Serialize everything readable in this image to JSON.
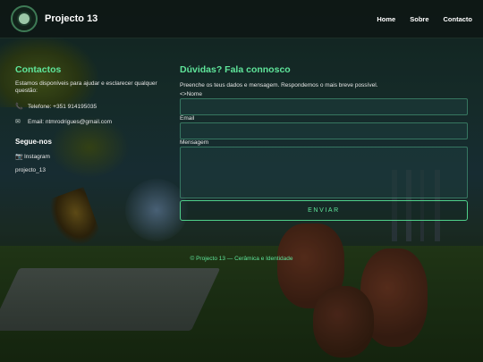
{
  "header": {
    "brand": "Projecto 13",
    "nav": [
      "Home",
      "Sobre",
      "Contacto"
    ]
  },
  "contacts": {
    "title": "Contactos",
    "intro": "Estamos disponíveis para ajudar e esclarecer qualquer questão:",
    "phone": "Telefone: +351 914195035",
    "email": "Email: ntmrodrigues@gmail.com",
    "follow_title": "Segue-nos",
    "instagram": "Instagram",
    "handle": "projecto_13",
    "icons": {
      "phone": "phone-icon",
      "email": "envelope-icon",
      "instagram": "camera-icon"
    }
  },
  "form": {
    "title": "Dúvidas? Fala connosco",
    "subtitle": "Preenche os teus dados e mensagem. Respondemos o mais breve possível.",
    "name_label": "<>Nome",
    "email_label": "Email",
    "message_label": "Mensagem",
    "send_label": "ENVIAR"
  },
  "footer": {
    "text": "© Projecto 13 — Cerâmica e Identidade"
  },
  "colors": {
    "accent": "#5fe59a",
    "header_bg": "#0e1614"
  }
}
